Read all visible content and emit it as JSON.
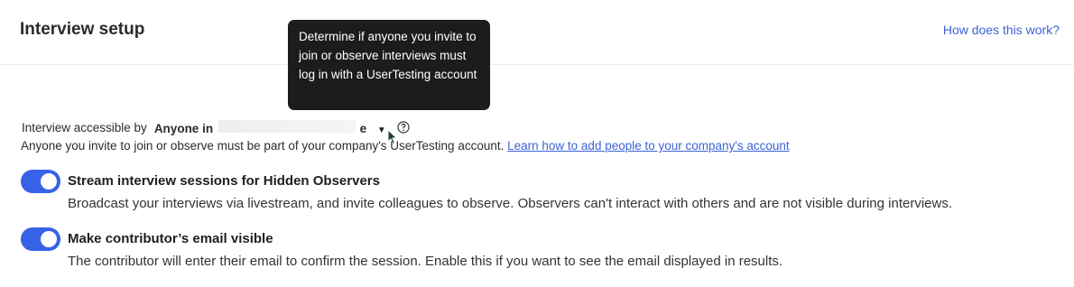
{
  "header": {
    "title": "Interview setup",
    "help_link": "How does this work?"
  },
  "tooltip": {
    "text": "Determine if anyone you invite to join or observe interviews must log in with a UserTesting account"
  },
  "access": {
    "label": "Interview accessible by",
    "value_prefix": "Anyone in",
    "value_suffix": "e",
    "description": "Anyone you invite to join or observe must be part of your company's UserTesting account.",
    "link": "Learn how to add people to your company's account"
  },
  "settings": [
    {
      "title": "Stream interview sessions for Hidden Observers",
      "description": "Broadcast your interviews via livestream, and invite colleagues to observe. Observers can't interact with others and are not visible during interviews.",
      "enabled": true
    },
    {
      "title": "Make contributor’s email visible",
      "description": "The contributor will enter their email to confirm the session. Enable this if you want to see the email displayed in results.",
      "enabled": true
    }
  ],
  "colors": {
    "accent": "#3762e8",
    "link": "#3b63d8",
    "tooltip_bg": "#1c1c1c"
  },
  "icons": [
    "caret-down-icon",
    "question-circle-icon",
    "mouse-cursor-icon"
  ]
}
